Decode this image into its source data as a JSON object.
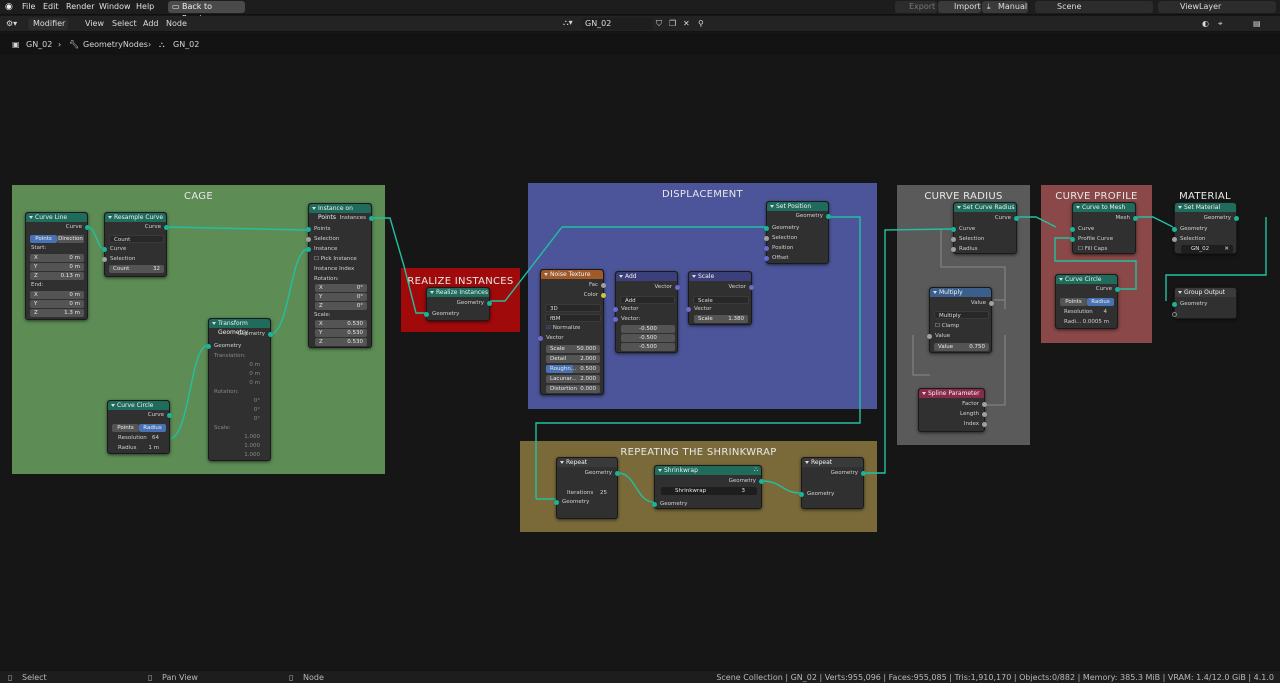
{
  "menubar": {
    "items": [
      "File",
      "Edit",
      "Render",
      "Window",
      "Help"
    ],
    "back_button": "Back to Previous",
    "export": "Export",
    "import": "Import",
    "manual": "Manual",
    "scene": "Scene",
    "viewlayer": "ViewLayer"
  },
  "editor_header": {
    "mode": "Modifier",
    "menus": [
      "View",
      "Select",
      "Add",
      "Node"
    ],
    "tree_name": "GN_02"
  },
  "breadcrumb": {
    "object": "GN_02",
    "modifier": "GeometryNodes",
    "tree": "GN_02"
  },
  "frames": {
    "cage": "CAGE",
    "realize": "REALIZE INSTANCES",
    "displacement": "DISPLACEMENT",
    "radius": "CURVE RADIUS",
    "profile": "CURVE PROFILE",
    "material": "MATERIAL",
    "shrink": "REPEATING THE SHRINKWRAP"
  },
  "nodes": {
    "curve_line": {
      "title": "Curve Line",
      "out": "Curve",
      "seg_a": "Points",
      "seg_b": "Direction",
      "start": "Start:",
      "x": "X",
      "y": "Y",
      "z": "Z",
      "sx": "0 m",
      "sy": "0 m",
      "sz": "0.13 m",
      "end": "End:",
      "ex": "0 m",
      "ey": "0 m",
      "ez": "1.3 m"
    },
    "resample": {
      "title": "Resample Curve",
      "out": "Curve",
      "mode": "Count",
      "curve": "Curve",
      "selection": "Selection",
      "count_label": "Count",
      "count": "32"
    },
    "curve_circle": {
      "title": "Curve Circle",
      "out": "Curve",
      "seg_a": "Points",
      "seg_b": "Radius",
      "res_label": "Resolution",
      "res": "64",
      "rad_label": "Radius",
      "rad": "1 m"
    },
    "transform": {
      "title": "Transform Geometry",
      "out": "Geometry",
      "geo": "Geometry",
      "translation": "Translation:",
      "tx": "0 m",
      "ty": "0 m",
      "tz": "0 m",
      "rotation": "Rotation:",
      "rx": "0°",
      "ry": "0°",
      "rz": "0°",
      "scale": "Scale:",
      "scx": "1.000",
      "scy": "1.000",
      "scz": "1.000"
    },
    "instance_on_points": {
      "title": "Instance on Points",
      "out": "Instances",
      "points": "Points",
      "selection": "Selection",
      "instance": "Instance",
      "pick": "Pick Instance",
      "index": "Instance Index",
      "rotation": "Rotation:",
      "rx": "0°",
      "ry": "0°",
      "rz": "0°",
      "scale": "Scale:",
      "sx": "0.530",
      "sy": "0.530",
      "sz": "0.530"
    },
    "realize": {
      "title": "Realize Instances",
      "out": "Geometry",
      "in": "Geometry"
    },
    "noise": {
      "title": "Noise Texture",
      "fac": "Fac",
      "color": "Color",
      "dim": "3D",
      "type": "fBM",
      "normalize": "Normalize",
      "vector": "Vector",
      "scale_l": "Scale",
      "scale": "50.000",
      "detail_l": "Detail",
      "detail": "2.000",
      "rough_l": "Roughn...",
      "rough": "0.500",
      "lac_l": "Lacunar...",
      "lac": "2.000",
      "dist_l": "Distortion",
      "dist": "0.000"
    },
    "add": {
      "title": "Add",
      "out": "Vector",
      "op": "Add",
      "v1": "Vector",
      "v2": "Vector:",
      "a": "-0.500",
      "b": "-0.500",
      "c": "-0.500"
    },
    "scale": {
      "title": "Scale",
      "out": "Vector",
      "op": "Scale",
      "vec": "Vector",
      "scale_l": "Scale",
      "scale": "1.380"
    },
    "set_position": {
      "title": "Set Position",
      "out": "Geometry",
      "geo": "Geometry",
      "sel": "Selection",
      "pos": "Position",
      "off": "Offset"
    },
    "repeat_in": {
      "title": "Repeat",
      "out": "Geometry",
      "iter_l": "Iterations",
      "iter": "25",
      "geo": "Geometry"
    },
    "shrinkwrap": {
      "title": "Shrinkwrap",
      "out": "Geometry",
      "group": "Shrinkwrap",
      "users": "3",
      "geo": "Geometry"
    },
    "repeat_out": {
      "title": "Repeat",
      "out": "Geometry",
      "geo": "Geometry"
    },
    "set_radius": {
      "title": "Set Curve Radius",
      "out": "Curve",
      "curve": "Curve",
      "sel": "Selection",
      "rad": "Radius"
    },
    "multiply": {
      "title": "Multiply",
      "out": "Value",
      "op": "Multiply",
      "clamp": "Clamp",
      "v1": "Value",
      "v2_l": "Value",
      "v2": "0.750"
    },
    "spline_param": {
      "title": "Spline Parameter",
      "f": "Factor",
      "l": "Length",
      "i": "Index"
    },
    "curve_to_mesh": {
      "title": "Curve to Mesh",
      "out": "Mesh",
      "curve": "Curve",
      "profile": "Profile Curve",
      "fill": "Fill Caps"
    },
    "profile_circle": {
      "title": "Curve Circle",
      "out": "Curve",
      "seg_a": "Points",
      "seg_b": "Radius",
      "res_l": "Resolution",
      "res": "4",
      "rad_l": "Radi...",
      "rad": "0.0005 m"
    },
    "set_material": {
      "title": "Set Material",
      "out": "Geometry",
      "geo": "Geometry",
      "sel": "Selection",
      "mat": "GN_02"
    },
    "group_output": {
      "title": "Group Output",
      "geo": "Geometry"
    }
  },
  "statusbar": {
    "select": "Select",
    "pan": "Pan View",
    "node": "Node",
    "stats": "Scene Collection | GN_02 | Verts:955,096 | Faces:955,085 | Tris:1,910,170 | Objects:0/882 | Memory: 385.3 MiB | VRAM: 1.4/12.0 GiB | 4.1.0"
  },
  "colors": {
    "cage": "#5d8c55",
    "realize": "#a00a0a",
    "displacement": "#4c5599",
    "radius": "#5a5a5a",
    "profile": "#8a4848",
    "shrink": "#7a6a3a",
    "link": "#22c0a0"
  }
}
